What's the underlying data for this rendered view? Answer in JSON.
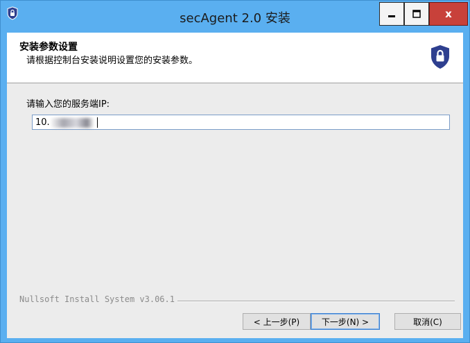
{
  "window": {
    "title": "secAgent 2.0 安装",
    "controls": {
      "minimize": "minimize-icon",
      "maximize": "maximize-icon",
      "close": "close-icon",
      "close_label": "x"
    },
    "accent_color": "#5aaff0",
    "close_color": "#c8413a"
  },
  "header": {
    "title": "安装参数设置",
    "subtitle": "请根据控制台安装说明设置您的安装参数。",
    "icon": "shield-lock-icon"
  },
  "form": {
    "ip_label": "请输入您的服务端IP:",
    "ip_value": "10."
  },
  "footer": {
    "branding": "Nullsoft Install System v3.06.1",
    "back_label": "< 上一步(P)",
    "next_label": "下一步(N) >",
    "cancel_label": "取消(C)"
  }
}
